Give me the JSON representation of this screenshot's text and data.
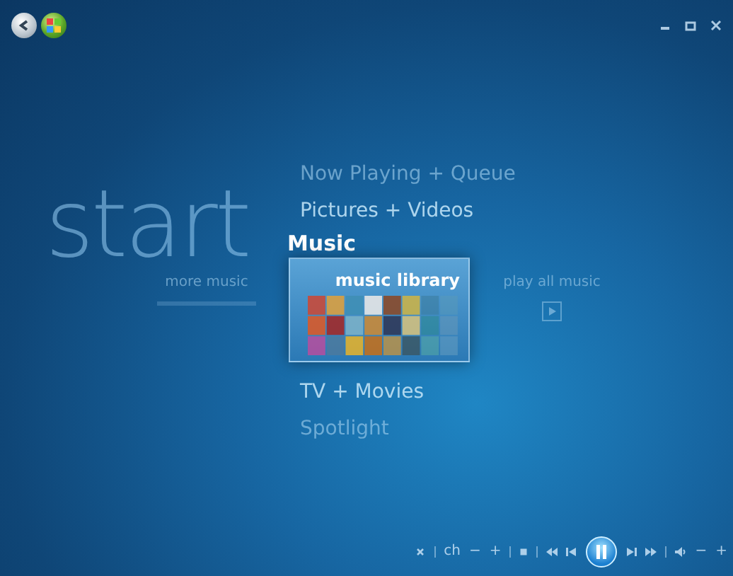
{
  "background_title": "start",
  "categories_above": [
    {
      "label": "Now Playing + Queue",
      "faded": true
    },
    {
      "label": "Pictures + Videos",
      "faded": false
    }
  ],
  "current_category": {
    "label": "Music",
    "strip": [
      {
        "label": "more music",
        "kind": "side",
        "selected": false
      },
      {
        "label": "music library",
        "kind": "tile",
        "selected": true
      },
      {
        "label": "play all music",
        "kind": "play",
        "selected": false
      }
    ]
  },
  "categories_below": [
    {
      "label": "TV + Movies",
      "faded": false
    },
    {
      "label": "Spotlight",
      "faded": true
    }
  ],
  "transport": {
    "channel_label": "ch",
    "channel_down": "−",
    "channel_up": "+",
    "volume_down": "−",
    "volume_up": "+"
  }
}
